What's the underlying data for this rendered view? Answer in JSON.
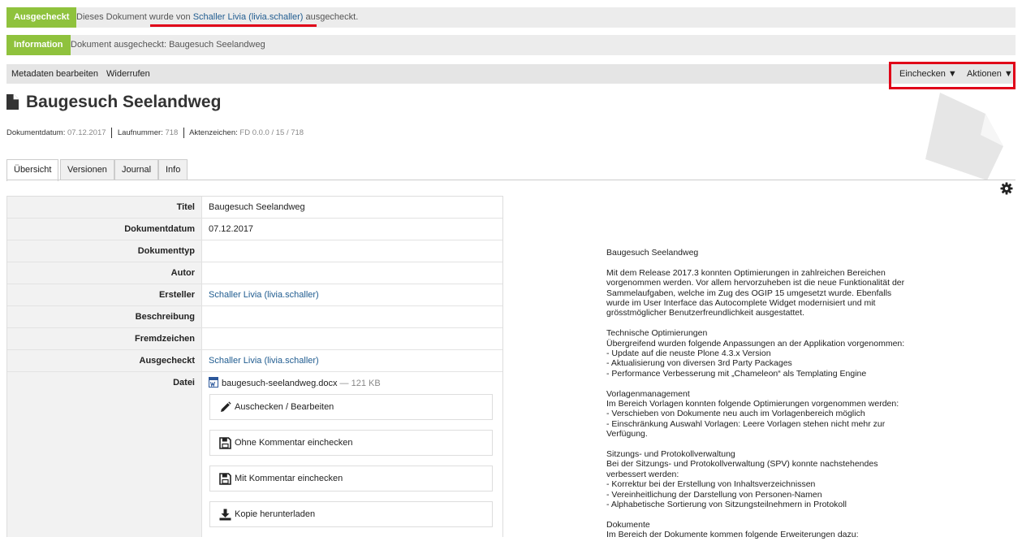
{
  "messages": {
    "checked_out": {
      "badge": "Ausgecheckt",
      "text_before": "Dieses Dokument wurde von ",
      "user_link": "Schaller Livia (livia.schaller)",
      "text_after": " ausgecheckt."
    },
    "information": {
      "badge": "Information",
      "text": "Dokument ausgecheckt: Baugesuch Seelandweg"
    }
  },
  "toolbar": {
    "edit_metadata": "Metadaten bearbeiten",
    "revoke": "Widerrufen",
    "checkin": "Einchecken ▼",
    "actions": "Aktionen ▼"
  },
  "document": {
    "title": "Baugesuch Seelandweg",
    "meta": {
      "date_label": "Dokumentdatum:",
      "date_value": "07.12.2017",
      "seq_label": "Laufnummer:",
      "seq_value": "718",
      "ref_label": "Aktenzeichen:",
      "ref_value": "FD 0.0.0 / 15 / 718"
    }
  },
  "tabs": [
    {
      "label": "Übersicht",
      "active": true
    },
    {
      "label": "Versionen",
      "active": false
    },
    {
      "label": "Journal",
      "active": false
    },
    {
      "label": "Info",
      "active": false
    }
  ],
  "fields": {
    "titel": {
      "label": "Titel",
      "value": "Baugesuch Seelandweg"
    },
    "dokumentdatum": {
      "label": "Dokumentdatum",
      "value": "07.12.2017"
    },
    "dokumenttyp": {
      "label": "Dokumenttyp",
      "value": ""
    },
    "autor": {
      "label": "Autor",
      "value": ""
    },
    "ersteller": {
      "label": "Ersteller",
      "value": "Schaller Livia (livia.schaller)"
    },
    "beschreibung": {
      "label": "Beschreibung",
      "value": ""
    },
    "fremdzeichen": {
      "label": "Fremdzeichen",
      "value": ""
    },
    "ausgecheckt": {
      "label": "Ausgecheckt",
      "value": "Schaller Livia (livia.schaller)"
    },
    "datei": {
      "label": "Datei",
      "filename": "baugesuch-seelandweg.docx",
      "size": " — 121 KB"
    }
  },
  "file_actions": {
    "checkout_edit": "Auschecken / Bearbeiten",
    "checkin_no_comment": "Ohne Kommentar einchecken",
    "checkin_comment": "Mit Kommentar einchecken",
    "download_copy": "Kopie herunterladen"
  },
  "preview": {
    "paragraphs": [
      "Baugesuch Seelandweg",
      "Mit dem Release 2017.3 konnten Optimierungen in zahlreichen Bereichen\nvorgenommen werden. Vor allem hervorzuheben ist die neue Funktionalität der\nSammelaufgaben, welche im Zug des OGIP 15 umgesetzt wurde. Ebenfalls\nwurde im User Interface das Autocomplete Widget modernisiert und mit\ngrösstmöglicher Benutzerfreundlichkeit ausgestattet.",
      "Technische Optimierungen\nÜbergreifend wurden folgende Anpassungen an der Applikation vorgenommen:\n - Update auf die neuste Plone 4.3.x Version\n - Aktualisierung von diversen 3rd Party Packages\n - Performance Verbesserung mit „Chameleon“ als Templating Engine",
      "Vorlagenmanagement\nIm Bereich Vorlagen konnten folgende Optimierungen vorgenommen werden:\n - Verschieben von Dokumente neu auch im Vorlagenbereich möglich\n - Einschränkung Auswahl Vorlagen: Leere Vorlagen stehen nicht mehr zur\nVerfügung.",
      "Sitzungs- und Protokollverwaltung\nBei der Sitzungs- und Protokollverwaltung (SPV) konnte nachstehendes\nverbessert werden:\n - Korrektur bei der Erstellung von Inhaltsverzeichnissen\n - Vereinheitlichung der Darstellung von Personen-Namen\n - Alphabetische Sortierung von Sitzungsteilnehmern in Protokoll",
      "Dokumente\nIm Bereich der Dokumente kommen folgende Erweiterungen dazu:"
    ]
  },
  "colors": {
    "badge_green": "#8fc23d",
    "highlight_red": "#e00018",
    "link_blue": "#205c90"
  }
}
